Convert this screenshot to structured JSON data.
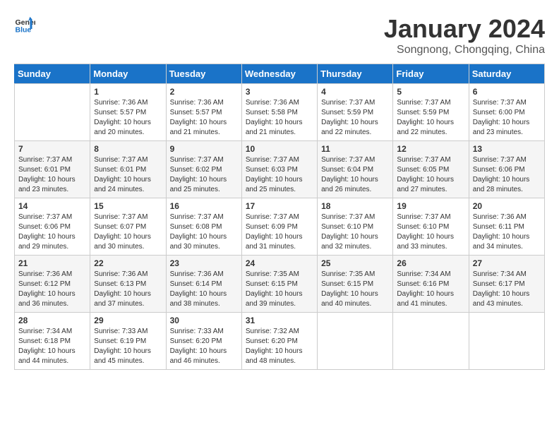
{
  "header": {
    "logo_line1": "General",
    "logo_line2": "Blue",
    "title": "January 2024",
    "subtitle": "Songnong, Chongqing, China"
  },
  "weekdays": [
    "Sunday",
    "Monday",
    "Tuesday",
    "Wednesday",
    "Thursday",
    "Friday",
    "Saturday"
  ],
  "weeks": [
    [
      {
        "day": "",
        "sunrise": "",
        "sunset": "",
        "daylight": ""
      },
      {
        "day": "1",
        "sunrise": "Sunrise: 7:36 AM",
        "sunset": "Sunset: 5:57 PM",
        "daylight": "Daylight: 10 hours and 20 minutes."
      },
      {
        "day": "2",
        "sunrise": "Sunrise: 7:36 AM",
        "sunset": "Sunset: 5:57 PM",
        "daylight": "Daylight: 10 hours and 21 minutes."
      },
      {
        "day": "3",
        "sunrise": "Sunrise: 7:36 AM",
        "sunset": "Sunset: 5:58 PM",
        "daylight": "Daylight: 10 hours and 21 minutes."
      },
      {
        "day": "4",
        "sunrise": "Sunrise: 7:37 AM",
        "sunset": "Sunset: 5:59 PM",
        "daylight": "Daylight: 10 hours and 22 minutes."
      },
      {
        "day": "5",
        "sunrise": "Sunrise: 7:37 AM",
        "sunset": "Sunset: 5:59 PM",
        "daylight": "Daylight: 10 hours and 22 minutes."
      },
      {
        "day": "6",
        "sunrise": "Sunrise: 7:37 AM",
        "sunset": "Sunset: 6:00 PM",
        "daylight": "Daylight: 10 hours and 23 minutes."
      }
    ],
    [
      {
        "day": "7",
        "sunrise": "Sunrise: 7:37 AM",
        "sunset": "Sunset: 6:01 PM",
        "daylight": "Daylight: 10 hours and 23 minutes."
      },
      {
        "day": "8",
        "sunrise": "Sunrise: 7:37 AM",
        "sunset": "Sunset: 6:01 PM",
        "daylight": "Daylight: 10 hours and 24 minutes."
      },
      {
        "day": "9",
        "sunrise": "Sunrise: 7:37 AM",
        "sunset": "Sunset: 6:02 PM",
        "daylight": "Daylight: 10 hours and 25 minutes."
      },
      {
        "day": "10",
        "sunrise": "Sunrise: 7:37 AM",
        "sunset": "Sunset: 6:03 PM",
        "daylight": "Daylight: 10 hours and 25 minutes."
      },
      {
        "day": "11",
        "sunrise": "Sunrise: 7:37 AM",
        "sunset": "Sunset: 6:04 PM",
        "daylight": "Daylight: 10 hours and 26 minutes."
      },
      {
        "day": "12",
        "sunrise": "Sunrise: 7:37 AM",
        "sunset": "Sunset: 6:05 PM",
        "daylight": "Daylight: 10 hours and 27 minutes."
      },
      {
        "day": "13",
        "sunrise": "Sunrise: 7:37 AM",
        "sunset": "Sunset: 6:06 PM",
        "daylight": "Daylight: 10 hours and 28 minutes."
      }
    ],
    [
      {
        "day": "14",
        "sunrise": "Sunrise: 7:37 AM",
        "sunset": "Sunset: 6:06 PM",
        "daylight": "Daylight: 10 hours and 29 minutes."
      },
      {
        "day": "15",
        "sunrise": "Sunrise: 7:37 AM",
        "sunset": "Sunset: 6:07 PM",
        "daylight": "Daylight: 10 hours and 30 minutes."
      },
      {
        "day": "16",
        "sunrise": "Sunrise: 7:37 AM",
        "sunset": "Sunset: 6:08 PM",
        "daylight": "Daylight: 10 hours and 30 minutes."
      },
      {
        "day": "17",
        "sunrise": "Sunrise: 7:37 AM",
        "sunset": "Sunset: 6:09 PM",
        "daylight": "Daylight: 10 hours and 31 minutes."
      },
      {
        "day": "18",
        "sunrise": "Sunrise: 7:37 AM",
        "sunset": "Sunset: 6:10 PM",
        "daylight": "Daylight: 10 hours and 32 minutes."
      },
      {
        "day": "19",
        "sunrise": "Sunrise: 7:37 AM",
        "sunset": "Sunset: 6:10 PM",
        "daylight": "Daylight: 10 hours and 33 minutes."
      },
      {
        "day": "20",
        "sunrise": "Sunrise: 7:36 AM",
        "sunset": "Sunset: 6:11 PM",
        "daylight": "Daylight: 10 hours and 34 minutes."
      }
    ],
    [
      {
        "day": "21",
        "sunrise": "Sunrise: 7:36 AM",
        "sunset": "Sunset: 6:12 PM",
        "daylight": "Daylight: 10 hours and 36 minutes."
      },
      {
        "day": "22",
        "sunrise": "Sunrise: 7:36 AM",
        "sunset": "Sunset: 6:13 PM",
        "daylight": "Daylight: 10 hours and 37 minutes."
      },
      {
        "day": "23",
        "sunrise": "Sunrise: 7:36 AM",
        "sunset": "Sunset: 6:14 PM",
        "daylight": "Daylight: 10 hours and 38 minutes."
      },
      {
        "day": "24",
        "sunrise": "Sunrise: 7:35 AM",
        "sunset": "Sunset: 6:15 PM",
        "daylight": "Daylight: 10 hours and 39 minutes."
      },
      {
        "day": "25",
        "sunrise": "Sunrise: 7:35 AM",
        "sunset": "Sunset: 6:15 PM",
        "daylight": "Daylight: 10 hours and 40 minutes."
      },
      {
        "day": "26",
        "sunrise": "Sunrise: 7:34 AM",
        "sunset": "Sunset: 6:16 PM",
        "daylight": "Daylight: 10 hours and 41 minutes."
      },
      {
        "day": "27",
        "sunrise": "Sunrise: 7:34 AM",
        "sunset": "Sunset: 6:17 PM",
        "daylight": "Daylight: 10 hours and 43 minutes."
      }
    ],
    [
      {
        "day": "28",
        "sunrise": "Sunrise: 7:34 AM",
        "sunset": "Sunset: 6:18 PM",
        "daylight": "Daylight: 10 hours and 44 minutes."
      },
      {
        "day": "29",
        "sunrise": "Sunrise: 7:33 AM",
        "sunset": "Sunset: 6:19 PM",
        "daylight": "Daylight: 10 hours and 45 minutes."
      },
      {
        "day": "30",
        "sunrise": "Sunrise: 7:33 AM",
        "sunset": "Sunset: 6:20 PM",
        "daylight": "Daylight: 10 hours and 46 minutes."
      },
      {
        "day": "31",
        "sunrise": "Sunrise: 7:32 AM",
        "sunset": "Sunset: 6:20 PM",
        "daylight": "Daylight: 10 hours and 48 minutes."
      },
      {
        "day": "",
        "sunrise": "",
        "sunset": "",
        "daylight": ""
      },
      {
        "day": "",
        "sunrise": "",
        "sunset": "",
        "daylight": ""
      },
      {
        "day": "",
        "sunrise": "",
        "sunset": "",
        "daylight": ""
      }
    ]
  ]
}
